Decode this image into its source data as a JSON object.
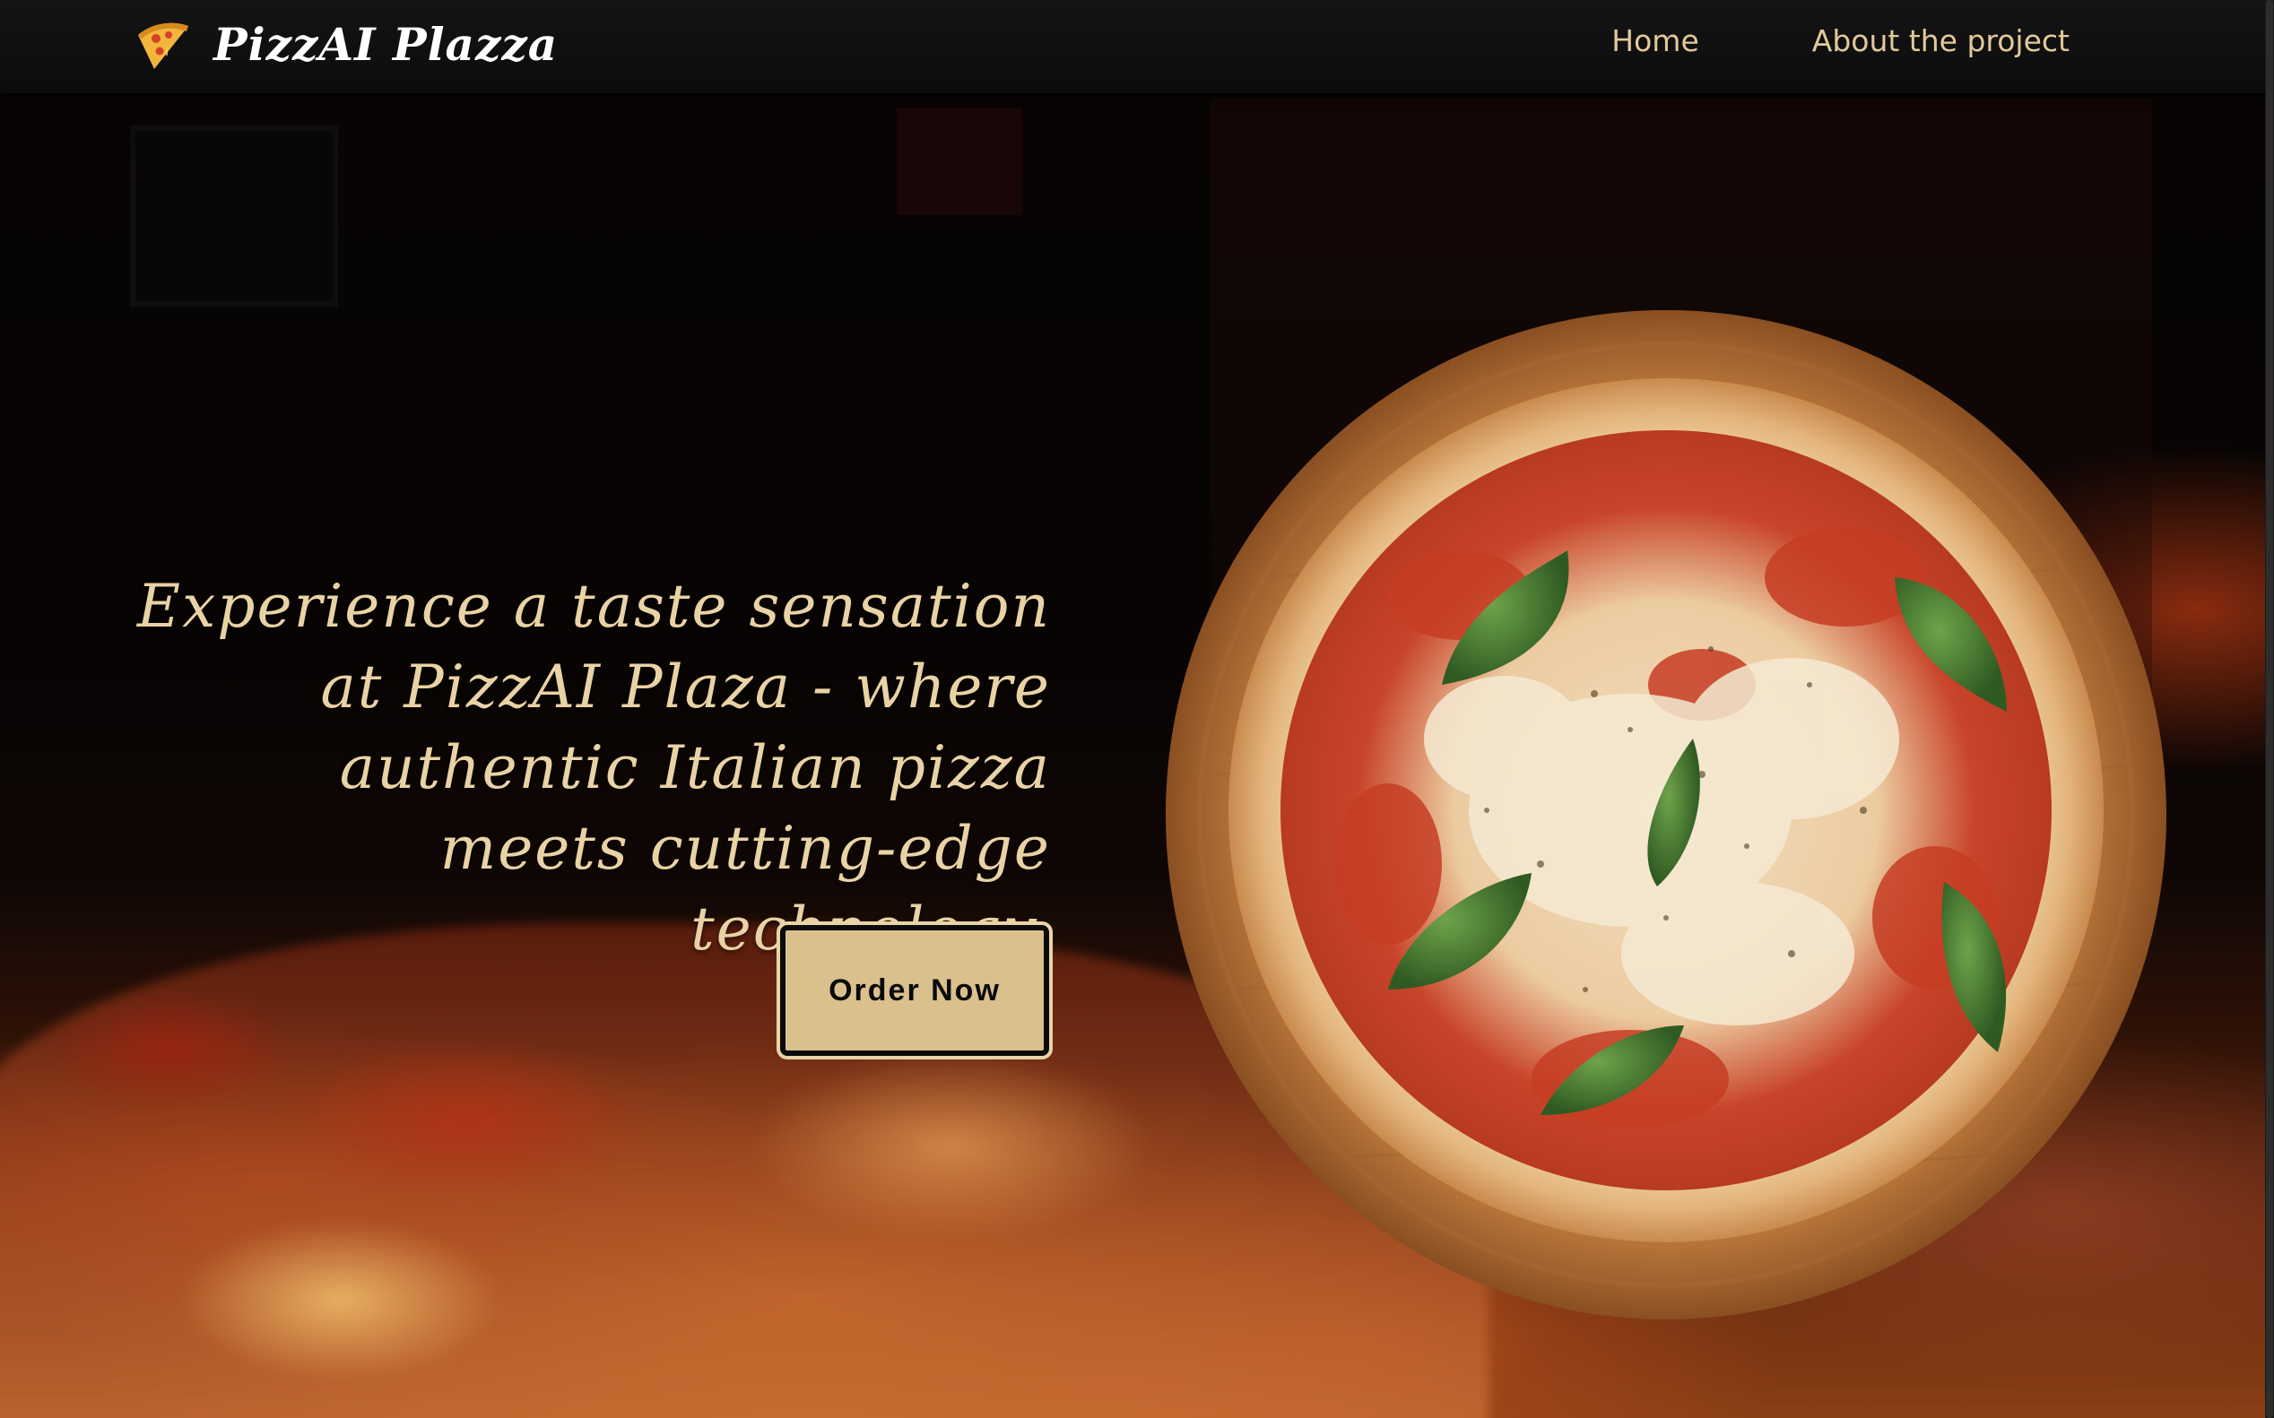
{
  "navbar": {
    "brand": {
      "name": "PizzAI Plazza",
      "icon": "pizza-slice-icon"
    },
    "links": [
      {
        "label": "Home"
      },
      {
        "label": "About the project"
      }
    ]
  },
  "hero": {
    "tagline_lines": [
      "Experience a taste sensation",
      "at PizzAI Plaza - where",
      "authentic Italian pizza",
      "meets cutting-edge technology."
    ],
    "cta_label": "Order Now",
    "image": "margherita-pizza-on-wooden-board"
  },
  "colors": {
    "accent": "#d9c08c",
    "nav_link": "#e2c99a",
    "tagline": "#e9d2a4",
    "navbar_bg": "#111111"
  }
}
